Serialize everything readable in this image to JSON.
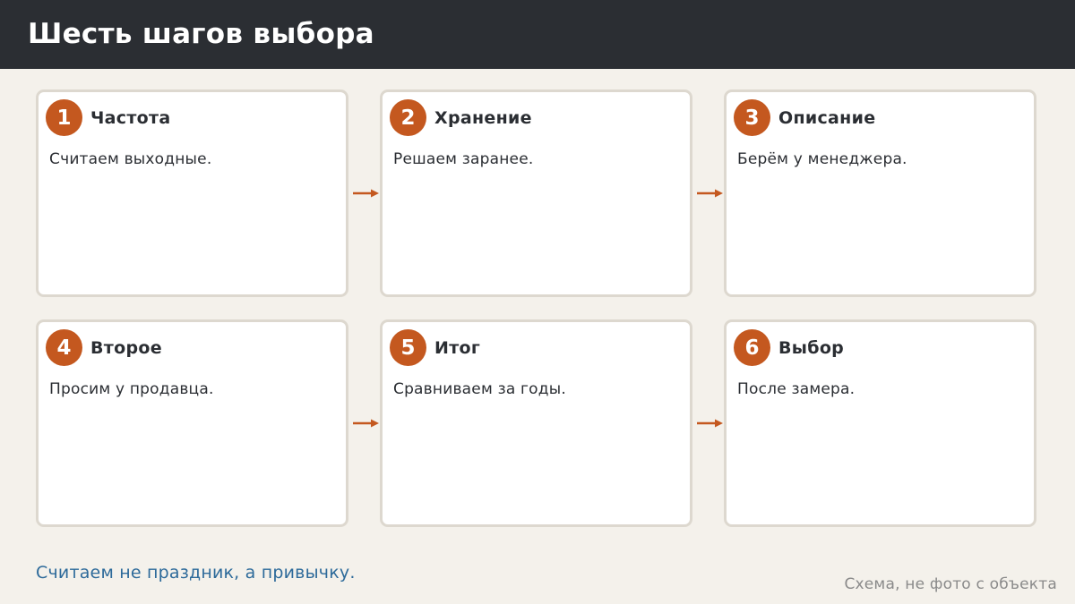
{
  "header": {
    "title": "Шесть шагов выбора"
  },
  "steps": [
    {
      "number": "1",
      "title": "Частота",
      "text": "Считаем выходные."
    },
    {
      "number": "2",
      "title": "Хранение",
      "text": "Решаем заранее."
    },
    {
      "number": "3",
      "title": "Описание",
      "text": "Берём у менеджера."
    },
    {
      "number": "4",
      "title": "Второе",
      "text": "Просим у продавца."
    },
    {
      "number": "5",
      "title": "Итог",
      "text": "Сравниваем за годы."
    },
    {
      "number": "6",
      "title": "Выбор",
      "text": "После замера."
    }
  ],
  "footer": {
    "note": "Считаем не праздник, а привычку.",
    "caption": "Схема, не фото с объекта"
  },
  "colors": {
    "accent": "#c4581f",
    "header_bg": "#2b2e33",
    "page_bg": "#f4f1eb",
    "note_text": "#2d6a9a"
  }
}
